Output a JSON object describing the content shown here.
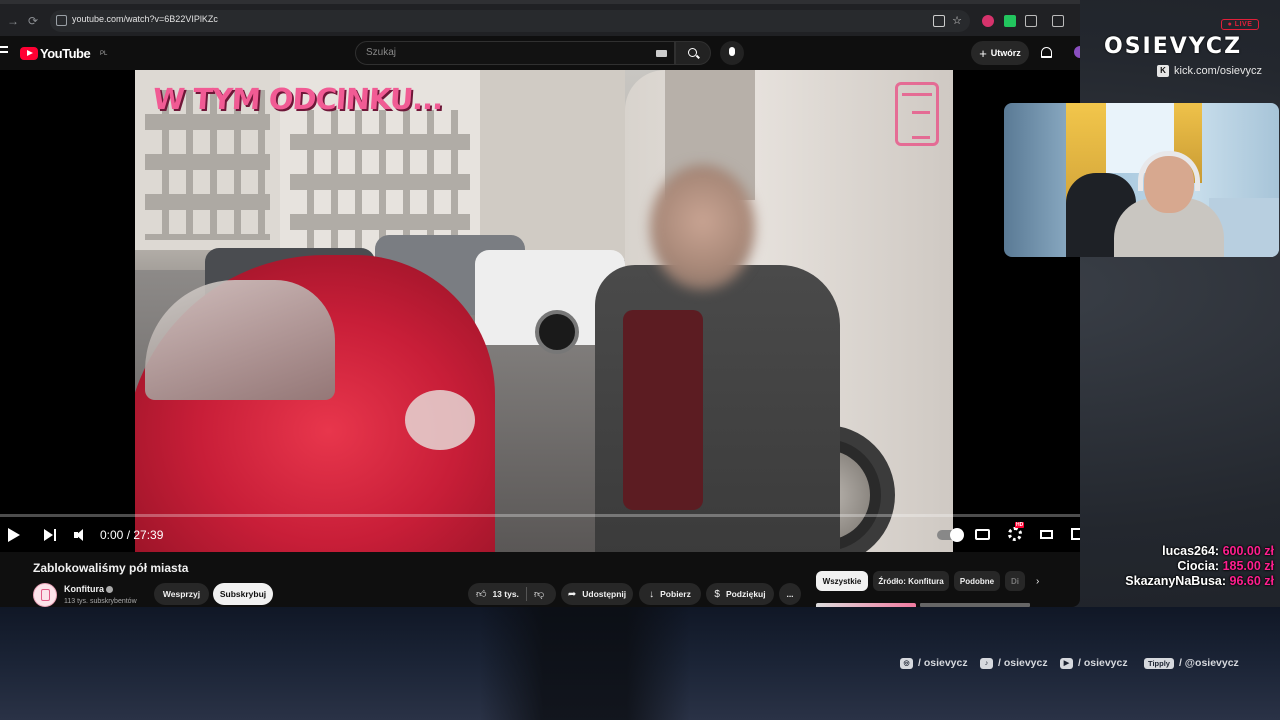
{
  "browser": {
    "url": "youtube.com/watch?v=6B22VIPlKZc"
  },
  "youtube": {
    "logo_text": "YouTube",
    "country_code": "PL",
    "search_placeholder": "Szukaj",
    "create_label": "Utwórz"
  },
  "player": {
    "overlay_text": "W TYM ODCINKU...",
    "time_current": "0:00",
    "time_total": "27:39",
    "progress_fraction": 0.0,
    "hd_badge": "HD"
  },
  "video": {
    "title": "Zablokowaliśmy pół miasta",
    "channel_name": "Konfitura",
    "subscribers": "113 tys. subskrybentów",
    "join_label": "Wesprzyj",
    "subscribe_label": "Subskrybuj",
    "likes": "13 tys.",
    "share_label": "Udostępnij",
    "download_label": "Pobierz",
    "thanks_label": "Podziękuj",
    "more_label": "..."
  },
  "recommendations": {
    "chips": [
      "Wszystkie",
      "Źródło: Konfitura",
      "Podobne",
      "Di"
    ]
  },
  "stream": {
    "live_badge": "● LIVE",
    "brand": "OSIEVYCZ",
    "kick_url": "kick.com/osievycz",
    "kick_icon": "K",
    "donations": [
      {
        "name": "lucas264:",
        "amount": "600.00 zł"
      },
      {
        "name": "Ciocia:",
        "amount": "185.00 zł"
      },
      {
        "name": "SkazanyNaBusa:",
        "amount": "96.60 zł"
      }
    ],
    "socials": {
      "instagram": "/ osievycz",
      "tiktok": "/ osievycz",
      "youtube": "/ osievycz",
      "tipply_badge": "Tipply",
      "tipply": "/ @osievycz"
    }
  },
  "colors": {
    "youtube_red": "#ff0033",
    "overlay_pink": "#f15b94",
    "donation_pink": "#ff1f8f",
    "live_red": "#e0203a"
  }
}
